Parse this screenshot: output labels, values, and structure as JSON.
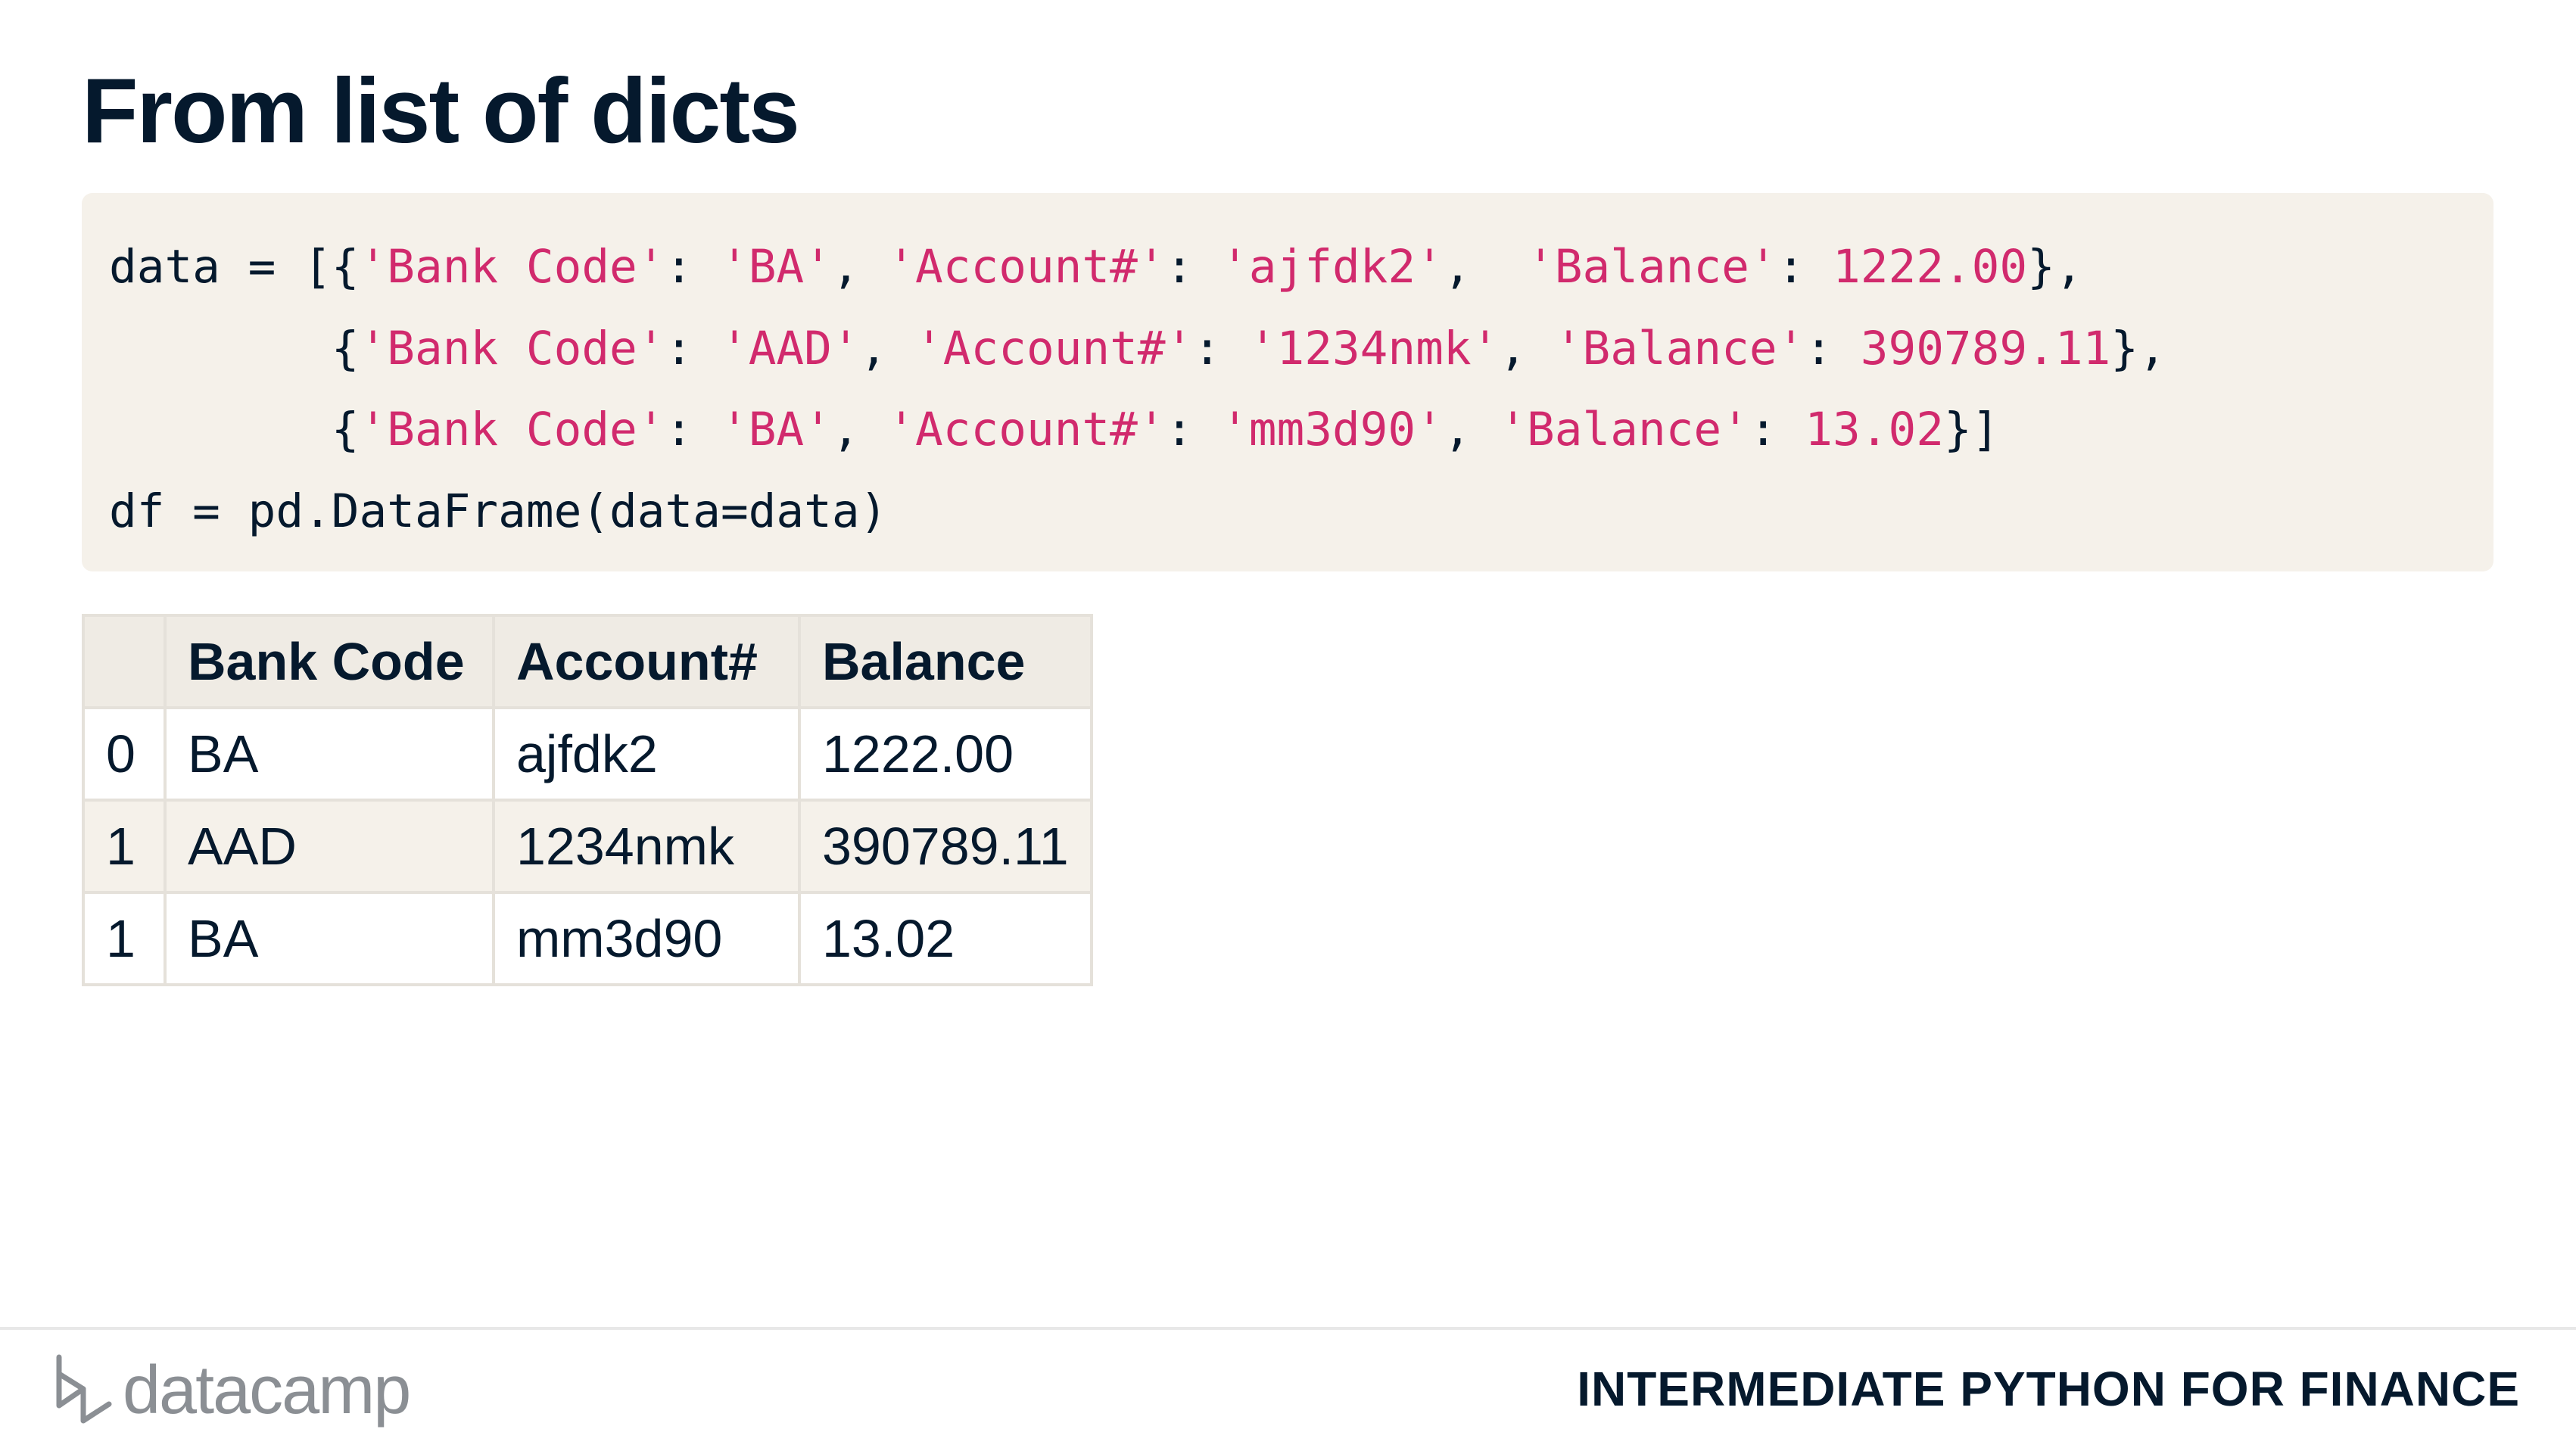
{
  "slide": {
    "title": "From list of dicts"
  },
  "code": {
    "line1": {
      "a": "data = [{",
      "s1": "'Bank Code'",
      "p1": ": ",
      "s2": "'BA'",
      "p2": ", ",
      "s3": "'Account#'",
      "p3": ": ",
      "s4": "'ajfdk2'",
      "p4": ",  ",
      "s5": "'Balance'",
      "p5": ": ",
      "n1": "1222.00",
      "end": "},"
    },
    "line2": {
      "a": "        {",
      "s1": "'Bank Code'",
      "p1": ": ",
      "s2": "'AAD'",
      "p2": ", ",
      "s3": "'Account#'",
      "p3": ": ",
      "s4": "'1234nmk'",
      "p4": ", ",
      "s5": "'Balance'",
      "p5": ": ",
      "n1": "390789.11",
      "end": "},"
    },
    "line3": {
      "a": "        {",
      "s1": "'Bank Code'",
      "p1": ": ",
      "s2": "'BA'",
      "p2": ", ",
      "s3": "'Account#'",
      "p3": ": ",
      "s4": "'mm3d90'",
      "p4": ", ",
      "s5": "'Balance'",
      "p5": ": ",
      "n1": "13.02",
      "end": "}]"
    },
    "line4": "df = pd.DataFrame(data=data)",
    "colors": {
      "background": "#f5f1ea",
      "string": "#d12a6d",
      "text": "#05192d"
    }
  },
  "table": {
    "headers": [
      "",
      "Bank Code",
      "Account#",
      "Balance"
    ],
    "rows": [
      [
        "0",
        "BA",
        "ajfdk2",
        "1222.00"
      ],
      [
        "1",
        "AAD",
        "1234nmk",
        "390789.11"
      ],
      [
        "1",
        "BA",
        "mm3d90",
        "13.02"
      ]
    ]
  },
  "footer": {
    "logo_text": "datacamp",
    "logo_icon": "datacamp-logo-icon",
    "course": "INTERMEDIATE PYTHON FOR FINANCE"
  }
}
